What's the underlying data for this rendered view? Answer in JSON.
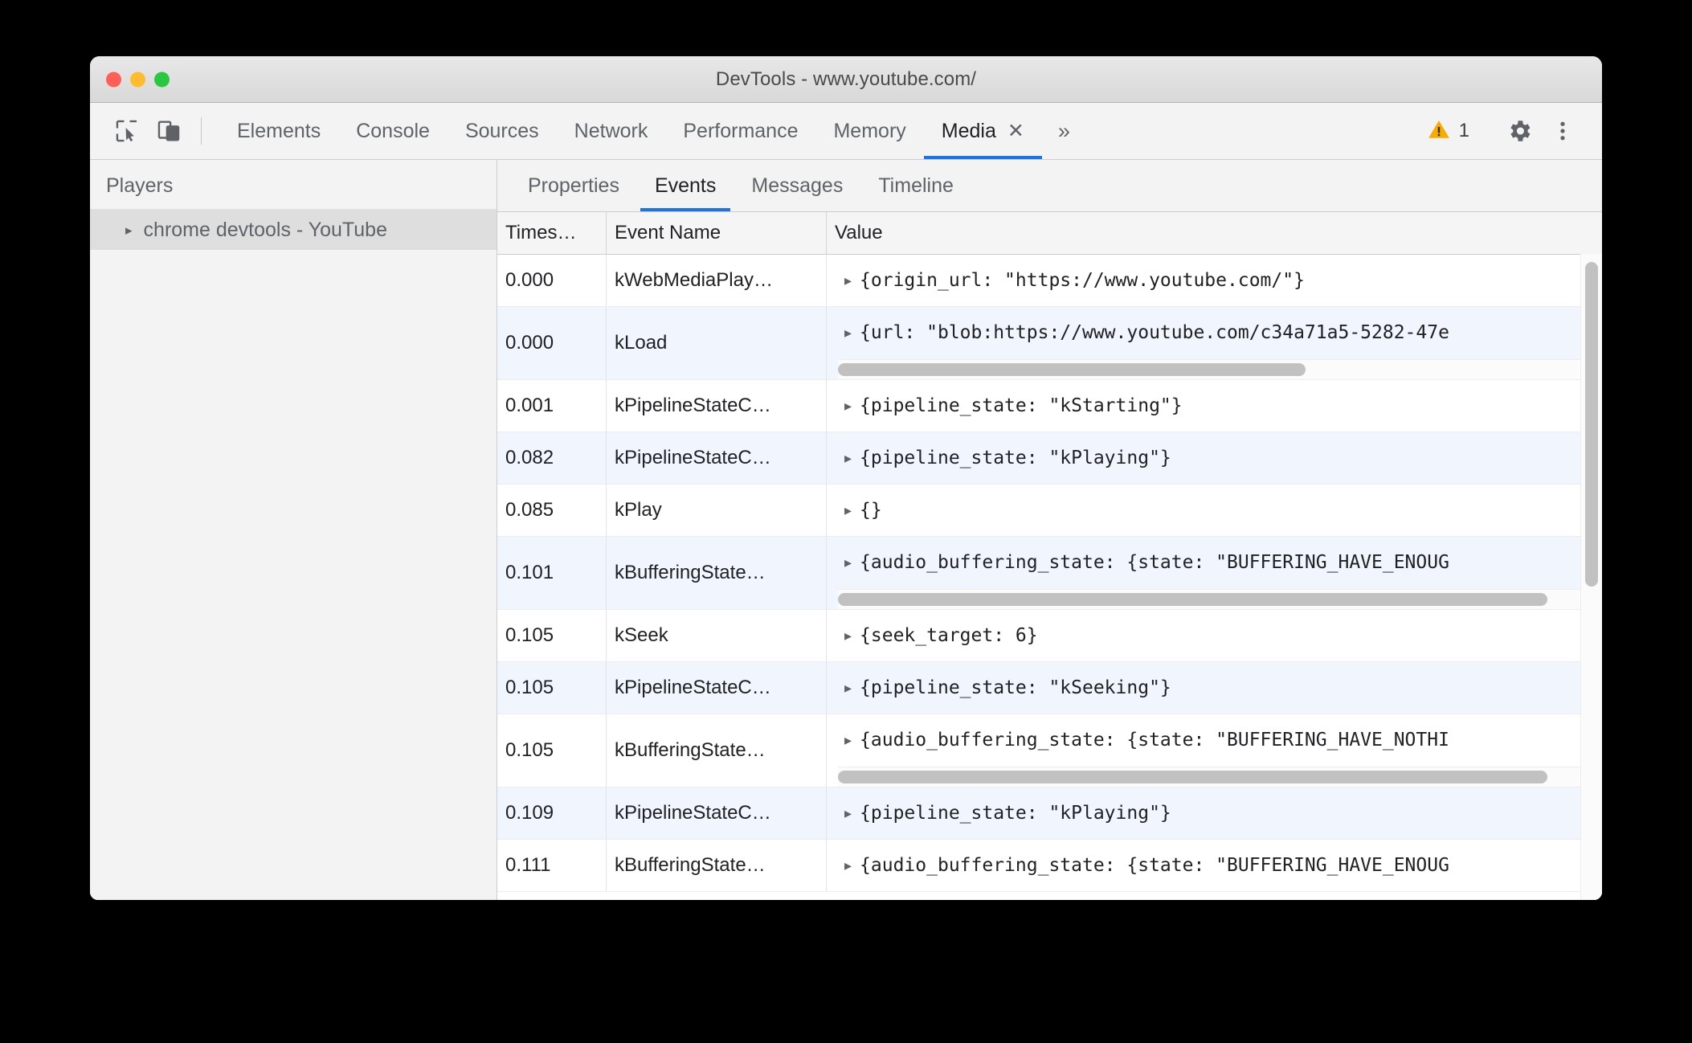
{
  "window": {
    "title": "DevTools - www.youtube.com/",
    "traffic_lights": [
      {
        "name": "close",
        "color": "#ff5f57"
      },
      {
        "name": "minimize",
        "color": "#febc2e"
      },
      {
        "name": "zoom",
        "color": "#28c840"
      }
    ]
  },
  "toolbar": {
    "inspect_icon": "inspect-element-icon",
    "device_icon": "device-toolbar-icon",
    "tabs": [
      {
        "label": "Elements",
        "active": false
      },
      {
        "label": "Console",
        "active": false
      },
      {
        "label": "Sources",
        "active": false
      },
      {
        "label": "Network",
        "active": false
      },
      {
        "label": "Performance",
        "active": false
      },
      {
        "label": "Memory",
        "active": false
      },
      {
        "label": "Media",
        "active": true
      }
    ],
    "active_tab": "Media",
    "close_tab_glyph": "✕",
    "more_tabs_glyph": "»",
    "warning_icon": "warning-triangle-icon",
    "warning_count": "1",
    "settings_icon": "gear-icon",
    "menu_icon": "more-vertical-icon",
    "accent_color": "#1a73e8",
    "warning_color": "#f9ab00"
  },
  "sidebar": {
    "header": "Players",
    "players": [
      {
        "label": "chrome devtools - YouTube",
        "selected": true,
        "disclosure": "▸"
      }
    ]
  },
  "subtabs": [
    {
      "label": "Properties",
      "active": false
    },
    {
      "label": "Events",
      "active": true
    },
    {
      "label": "Messages",
      "active": false
    },
    {
      "label": "Timeline",
      "active": false
    }
  ],
  "table": {
    "columns": [
      "Times…",
      "Event Name",
      "Value"
    ],
    "rows": [
      {
        "timestamp": "0.000",
        "event_name": "kWebMediaPlay…",
        "value": "{origin_url: \"https://www.youtube.com/\"}",
        "arrow": "▸",
        "alt": false,
        "scrollbar": false
      },
      {
        "timestamp": "0.000",
        "event_name": "kLoad",
        "value": "{url: \"blob:https://www.youtube.com/c34a71a5-5282-47e",
        "arrow": "▸",
        "alt": true,
        "scrollbar": true,
        "scroll_percent": 62
      },
      {
        "timestamp": "0.001",
        "event_name": "kPipelineStateC…",
        "value": "{pipeline_state: \"kStarting\"}",
        "arrow": "▸",
        "alt": false,
        "scrollbar": false
      },
      {
        "timestamp": "0.082",
        "event_name": "kPipelineStateC…",
        "value": "{pipeline_state: \"kPlaying\"}",
        "arrow": "▸",
        "alt": true,
        "scrollbar": false
      },
      {
        "timestamp": "0.085",
        "event_name": "kPlay",
        "value": "{}",
        "arrow": "▸",
        "alt": false,
        "scrollbar": false
      },
      {
        "timestamp": "0.101",
        "event_name": "kBufferingState…",
        "value": "{audio_buffering_state: {state: \"BUFFERING_HAVE_ENOUG",
        "arrow": "▸",
        "alt": true,
        "scrollbar": true,
        "scroll_percent": 94
      },
      {
        "timestamp": "0.105",
        "event_name": "kSeek",
        "value": "{seek_target: 6}",
        "arrow": "▸",
        "alt": false,
        "scrollbar": false
      },
      {
        "timestamp": "0.105",
        "event_name": "kPipelineStateC…",
        "value": "{pipeline_state: \"kSeeking\"}",
        "arrow": "▸",
        "alt": true,
        "scrollbar": false
      },
      {
        "timestamp": "0.105",
        "event_name": "kBufferingState…",
        "value": "{audio_buffering_state: {state: \"BUFFERING_HAVE_NOTHI",
        "arrow": "▸",
        "alt": false,
        "scrollbar": true,
        "scroll_percent": 94
      },
      {
        "timestamp": "0.109",
        "event_name": "kPipelineStateC…",
        "value": "{pipeline_state: \"kPlaying\"}",
        "arrow": "▸",
        "alt": true,
        "scrollbar": false
      },
      {
        "timestamp": "0.111",
        "event_name": "kBufferingState…",
        "value": "{audio_buffering_state: {state: \"BUFFERING_HAVE_ENOUG",
        "arrow": "▸",
        "alt": false,
        "scrollbar": false
      }
    ]
  }
}
